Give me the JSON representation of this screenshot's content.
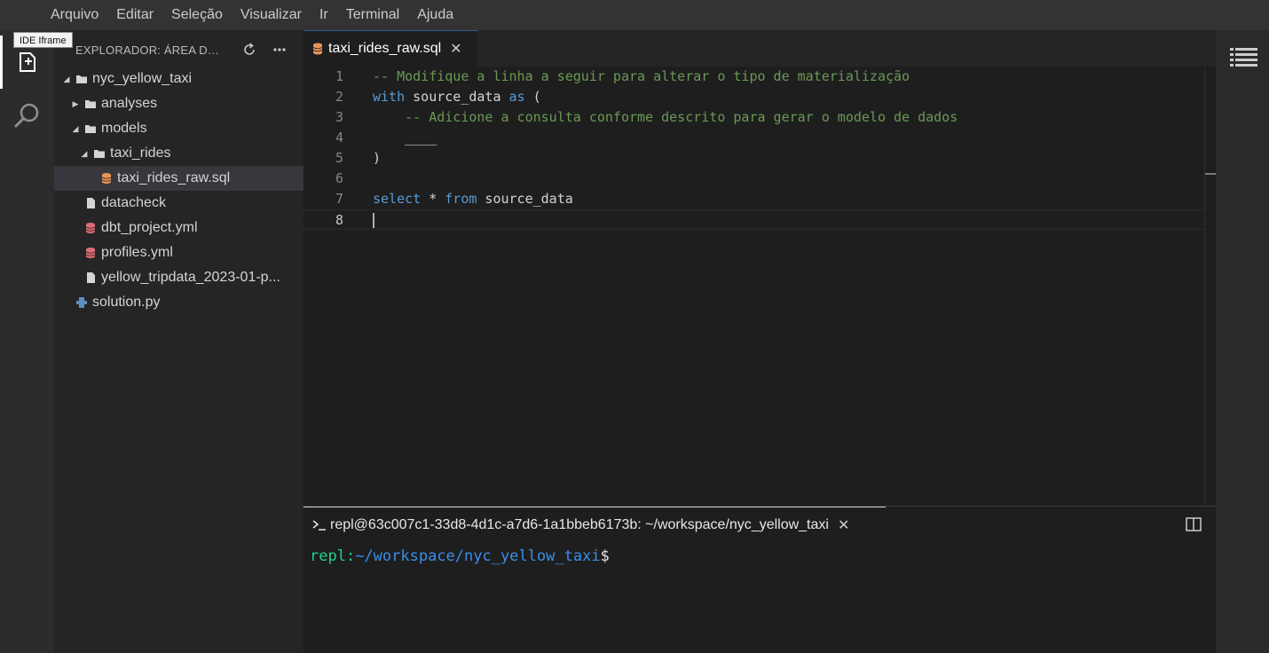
{
  "menu": [
    "Arquivo",
    "Editar",
    "Seleção",
    "Visualizar",
    "Ir",
    "Terminal",
    "Ajuda"
  ],
  "activity": {
    "tooltip": "IDE Iframe",
    "icons": [
      "files-icon",
      "search-icon"
    ]
  },
  "sidebar": {
    "title": "EXPLORADOR: ÁREA DE...",
    "tree": [
      {
        "label": "nyc_yellow_taxi",
        "type": "folder",
        "expanded": true,
        "depth": 0
      },
      {
        "label": "analyses",
        "type": "folder",
        "expanded": false,
        "depth": 1
      },
      {
        "label": "models",
        "type": "folder",
        "expanded": true,
        "depth": 1
      },
      {
        "label": "taxi_rides",
        "type": "folder",
        "expanded": true,
        "depth": 2
      },
      {
        "label": "taxi_rides_raw.sql",
        "type": "sql",
        "depth": 3,
        "selected": true
      },
      {
        "label": "datacheck",
        "type": "file",
        "depth": 1
      },
      {
        "label": "dbt_project.yml",
        "type": "yml",
        "depth": 1
      },
      {
        "label": "profiles.yml",
        "type": "yml",
        "depth": 1
      },
      {
        "label": "yellow_tripdata_2023-01-p...",
        "type": "file",
        "depth": 1
      },
      {
        "label": "solution.py",
        "type": "py",
        "depth": 0
      }
    ]
  },
  "editor": {
    "tab_label": "taxi_rides_raw.sql",
    "current_line": 8,
    "lines": [
      {
        "n": "1",
        "parts": [
          [
            "cmt",
            "-- Modifique a linha a seguir para alterar o tipo de materialização"
          ]
        ]
      },
      {
        "n": "2",
        "parts": [
          [
            "kw",
            "with"
          ],
          [
            "txt",
            " source_data "
          ],
          [
            "kw",
            "as"
          ],
          [
            "txt",
            " ("
          ]
        ]
      },
      {
        "n": "3",
        "parts": [
          [
            "cmt",
            "    -- Adicione a consulta conforme descrito para gerar o modelo de dados"
          ]
        ]
      },
      {
        "n": "4",
        "parts": [
          [
            "txt",
            "    ____"
          ]
        ]
      },
      {
        "n": "5",
        "parts": [
          [
            "txt",
            ")"
          ]
        ]
      },
      {
        "n": "6",
        "parts": []
      },
      {
        "n": "7",
        "parts": [
          [
            "kw",
            "select"
          ],
          [
            "txt",
            " * "
          ],
          [
            "kw",
            "from"
          ],
          [
            "txt",
            " source_data"
          ]
        ]
      },
      {
        "n": "8",
        "parts": []
      }
    ]
  },
  "terminal": {
    "tab_label": "repl@63c007c1-33d8-4d1c-a7d6-1a1bbeb6173b: ~/workspace/nyc_yellow_taxi",
    "prompt_user": "repl:",
    "prompt_path": "~/workspace/nyc_yellow_taxi",
    "prompt_sign": "$"
  },
  "colors": {
    "sql": "#e8955a",
    "yml": "#e06c75",
    "py": "#5c8fbf",
    "file": "#d4d4d4",
    "folder": "#d4d4d4"
  }
}
